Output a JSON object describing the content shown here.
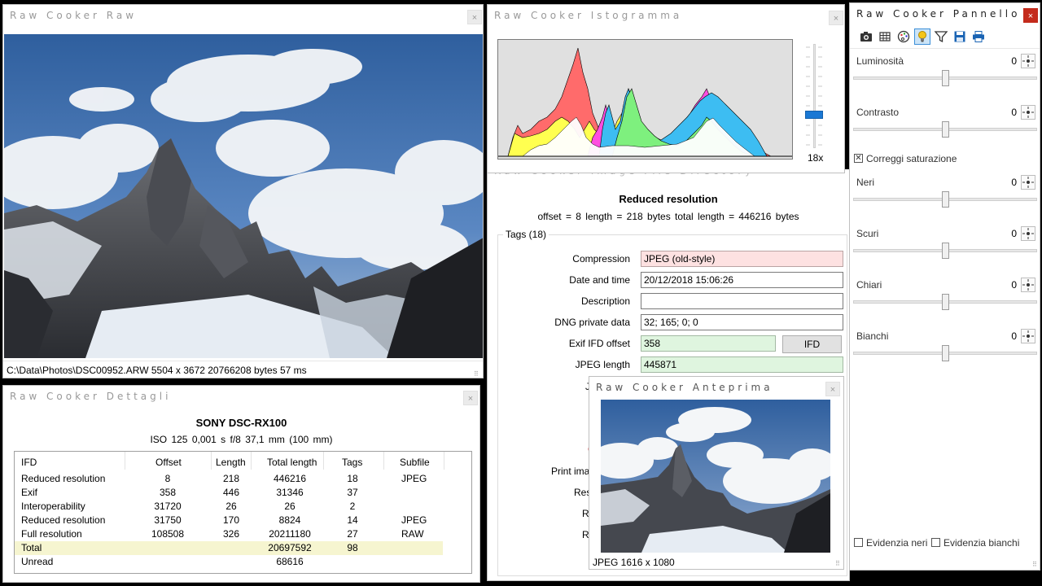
{
  "raw_window": {
    "title": "Raw Cooker Raw",
    "status": "C:\\Data\\Photos\\DSC00952.ARW   5504 x 3672   20766208 bytes   57 ms"
  },
  "details_window": {
    "title": "Raw Cooker Dettagli",
    "camera": "SONY DSC-RX100",
    "exposure": "ISO 125     0,001 s     f/8     37,1 mm (100 mm)",
    "columns": [
      "IFD",
      "Offset",
      "Length",
      "Total length",
      "Tags",
      "Subfile"
    ],
    "rows": [
      [
        "Reduced resolution",
        "8",
        "218",
        "446216",
        "18",
        "JPEG"
      ],
      [
        "Exif",
        "358",
        "446",
        "31346",
        "37",
        ""
      ],
      [
        "Interoperability",
        "31720",
        "26",
        "26",
        "2",
        ""
      ],
      [
        "Reduced resolution",
        "31750",
        "170",
        "8824",
        "14",
        "JPEG"
      ],
      [
        "Full resolution",
        "108508",
        "326",
        "20211180",
        "27",
        "RAW"
      ],
      [
        "Total",
        "",
        "",
        "20697592",
        "98",
        ""
      ],
      [
        "Unread",
        "",
        "",
        "68616",
        "",
        ""
      ]
    ]
  },
  "histogram_window": {
    "title": "Raw Cooker Istogramma",
    "zoom_label": "18x",
    "zoom_level": 0.3
  },
  "ifd_window": {
    "title": "Raw Cooker Image File Directory",
    "heading": "Reduced resolution",
    "summary": "offset = 8     length = 218 bytes     total length = 446216 bytes",
    "tags_legend": "Tags (18)",
    "tags": [
      {
        "label": "Compression",
        "value": "JPEG (old-style)",
        "style": "pink"
      },
      {
        "label": "Date and time",
        "value": "20/12/2018 15:06:26",
        "style": "plain"
      },
      {
        "label": "Description",
        "value": "",
        "style": "plain"
      },
      {
        "label": "DNG private data",
        "value": "32; 165; 0; 0",
        "style": "plain"
      },
      {
        "label": "Exif IFD offset",
        "value": "358",
        "style": "green"
      },
      {
        "label": "JPEG length",
        "value": "445871",
        "style": "green"
      }
    ],
    "ifd_button": "IFD",
    "partial_labels": [
      "J",
      "C",
      "Print image",
      "Rese",
      "Re",
      "Re"
    ]
  },
  "preview_window": {
    "title": "Raw Cooker Anteprima",
    "status": "JPEG   1616 x 1080"
  },
  "panel_window": {
    "title": "Raw Cooker Pannello",
    "close": "×",
    "toolbar": [
      "camera-icon",
      "grid-icon",
      "palette-icon",
      "bulb-icon",
      "filter-icon",
      "save-icon",
      "print-icon"
    ],
    "sliders": [
      {
        "label": "Luminosità",
        "value": "0",
        "level": 0.5
      },
      {
        "label": "Contrasto",
        "value": "0",
        "level": 0.5
      },
      {
        "label": "Neri",
        "value": "0",
        "level": 0.5
      },
      {
        "label": "Scuri",
        "value": "0",
        "level": 0.5
      },
      {
        "label": "Chiari",
        "value": "0",
        "level": 0.5
      },
      {
        "label": "Bianchi",
        "value": "0",
        "level": 0.5
      }
    ],
    "saturation_checkbox": "Correggi saturazione",
    "bottom_checks": [
      "Evidenzia neri",
      "Evidenzia bianchi"
    ]
  },
  "colors": {
    "sky": "#3f6fb0",
    "highlight_row": "#f6f5d0",
    "pink_field": "#fde1e1",
    "green_field": "#dff5df",
    "accent": "#1a64b4"
  }
}
